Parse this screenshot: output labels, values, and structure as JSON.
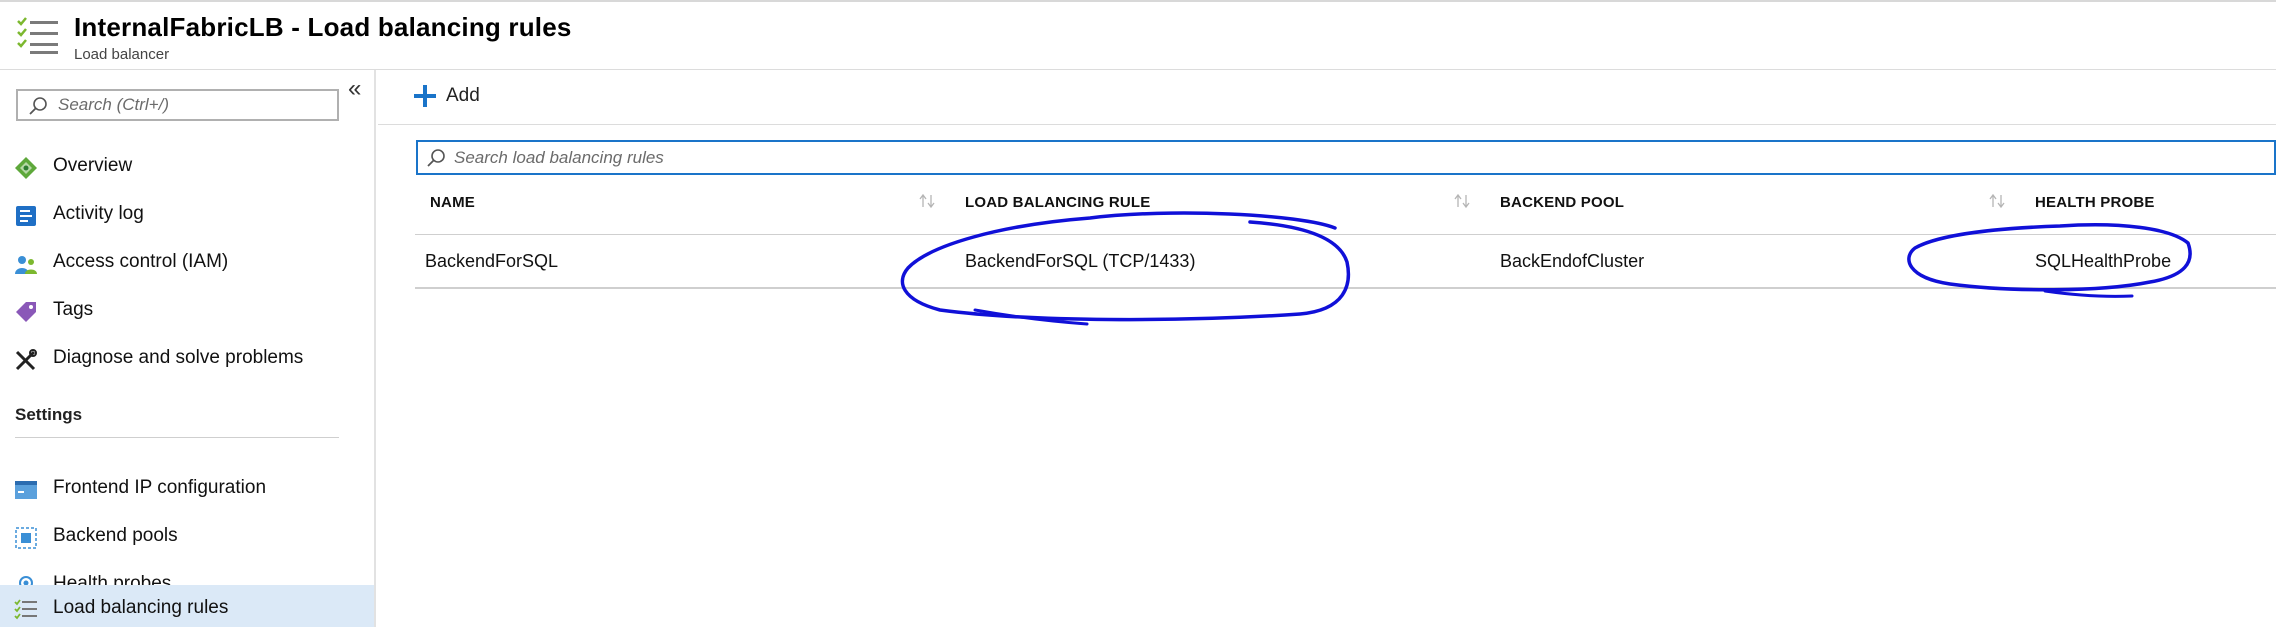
{
  "header": {
    "title": "InternalFabricLB - Load balancing rules",
    "subtitle": "Load balancer"
  },
  "sidebar": {
    "collapse_glyph": "«",
    "search_placeholder": "Search (Ctrl+/)",
    "items": [
      {
        "label": "Overview",
        "icon": "overview-icon"
      },
      {
        "label": "Activity log",
        "icon": "activity-log-icon"
      },
      {
        "label": "Access control (IAM)",
        "icon": "iam-icon"
      },
      {
        "label": "Tags",
        "icon": "tag-icon"
      },
      {
        "label": "Diagnose and solve problems",
        "icon": "wrench-icon"
      }
    ],
    "settings_heading": "Settings",
    "settings_items": [
      {
        "label": "Frontend IP configuration",
        "icon": "frontend-ip-icon"
      },
      {
        "label": "Backend pools",
        "icon": "backend-pool-icon"
      },
      {
        "label": "Health probes",
        "icon": "health-probe-icon"
      },
      {
        "label": "Load balancing rules",
        "icon": "rules-list-icon",
        "active": true
      }
    ]
  },
  "toolbar": {
    "add_label": "Add"
  },
  "grid": {
    "search_placeholder": "Search load balancing rules",
    "columns": [
      "NAME",
      "LOAD BALANCING RULE",
      "BACKEND POOL",
      "HEALTH PROBE"
    ],
    "rows": [
      {
        "name": "BackendForSQL",
        "rule": "BackendForSQL (TCP/1433)",
        "pool": "BackEndofCluster",
        "probe": "SQLHealthProbe"
      }
    ]
  },
  "colors": {
    "accent": "#1a74c9",
    "active_nav_bg": "#dbe9f7",
    "annotation_ink": "#1010d8"
  }
}
